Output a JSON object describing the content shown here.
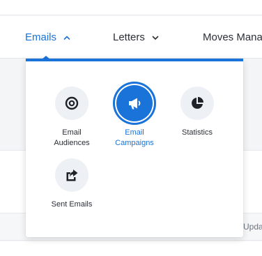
{
  "nav": {
    "emails_label": "Emails",
    "letters_label": "Letters",
    "moves_label": "Moves Mana"
  },
  "dropdown": {
    "items": [
      {
        "label_line1": "Email",
        "label_line2": "Audiences",
        "icon": "target-icon"
      },
      {
        "label_line1": "Email",
        "label_line2": "Campaigns",
        "icon": "megaphone-icon",
        "active": true
      },
      {
        "label_line1": "Statistics",
        "label_line2": "",
        "icon": "pie-chart-icon"
      },
      {
        "label_line1": "Sent Emails",
        "label_line2": "",
        "icon": "share-icon"
      }
    ]
  },
  "background": {
    "row_text": "Upda"
  },
  "colors": {
    "accent": "#1a73d9",
    "text": "#2b2f36",
    "icon_bg": "#edf0f4"
  }
}
